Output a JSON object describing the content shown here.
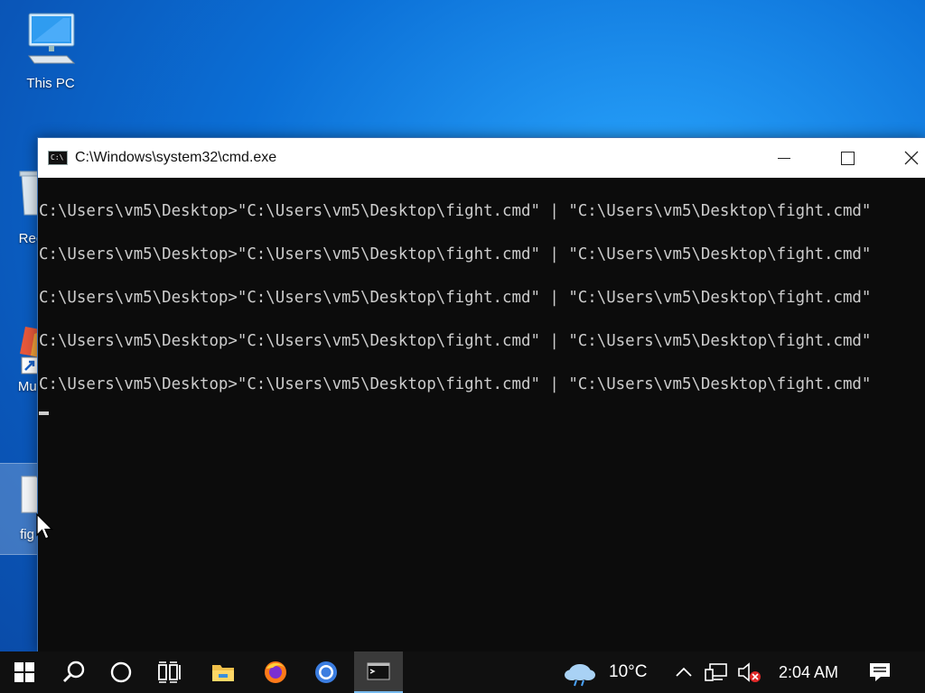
{
  "desktop": {
    "icons": [
      {
        "label": "This PC"
      },
      {
        "label": "Rec"
      },
      {
        "label": "Mult"
      },
      {
        "label": "fig"
      }
    ]
  },
  "window": {
    "title": "C:\\Windows\\system32\\cmd.exe",
    "icon_text": "C:\\",
    "lines": [
      "C:\\Users\\vm5\\Desktop>\"C:\\Users\\vm5\\Desktop\\fight.cmd\" | \"C:\\Users\\vm5\\Desktop\\fight.cmd\"",
      "C:\\Users\\vm5\\Desktop>\"C:\\Users\\vm5\\Desktop\\fight.cmd\" | \"C:\\Users\\vm5\\Desktop\\fight.cmd\"",
      "C:\\Users\\vm5\\Desktop>\"C:\\Users\\vm5\\Desktop\\fight.cmd\" | \"C:\\Users\\vm5\\Desktop\\fight.cmd\"",
      "C:\\Users\\vm5\\Desktop>\"C:\\Users\\vm5\\Desktop\\fight.cmd\" | \"C:\\Users\\vm5\\Desktop\\fight.cmd\"",
      "C:\\Users\\vm5\\Desktop>\"C:\\Users\\vm5\\Desktop\\fight.cmd\" | \"C:\\Users\\vm5\\Desktop\\fight.cmd\""
    ]
  },
  "taskbar": {
    "apps": [
      "start",
      "search",
      "cortana",
      "task-view",
      "file-explorer",
      "firefox",
      "chrome",
      "cmd"
    ],
    "weather": "10°C",
    "time": "2:04 AM"
  },
  "colors": {
    "desktop_accent": "#0b6fd6",
    "console_bg": "#0c0c0c",
    "console_text": "#cccccc",
    "taskbar_bg": "#101010",
    "active_indicator": "#76b9ed"
  }
}
